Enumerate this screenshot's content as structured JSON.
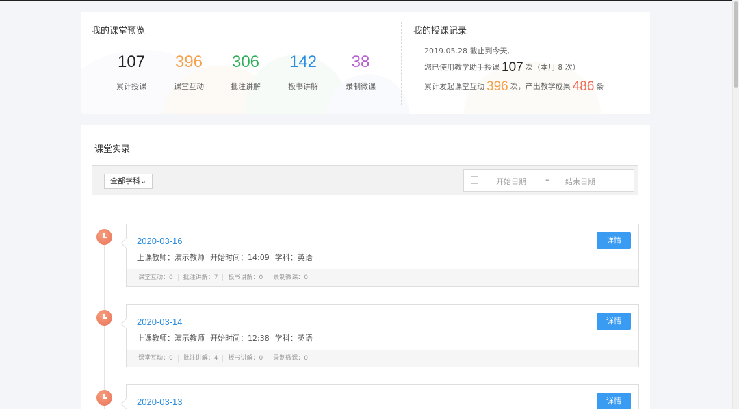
{
  "overview": {
    "title": "我的课堂预览",
    "stats": [
      {
        "value": "107",
        "label": "累计授课",
        "color": "#222222"
      },
      {
        "value": "396",
        "label": "课堂互动",
        "color": "#f5a04a"
      },
      {
        "value": "306",
        "label": "批注讲解",
        "color": "#2fae5a"
      },
      {
        "value": "142",
        "label": "板书讲解",
        "color": "#2b8de0"
      },
      {
        "value": "38",
        "label": "录制微课",
        "color": "#b35fd0"
      }
    ]
  },
  "teaching_record": {
    "title": "我的授课记录",
    "line1": "2019.05.28 截止到今天,",
    "line2_prefix": "您已使用教学助手授课",
    "line2_count": "107",
    "line2_suffix": "次（本月 8 次）",
    "line3_prefix": "累计发起课堂互动",
    "line3_count": "396",
    "line3_mid": "次，产出教学成果",
    "line3_count2": "486",
    "line3_suffix": "条",
    "colors": {
      "count1": "#222222",
      "count2": "#f5a04a",
      "count3": "#ef6b5a"
    }
  },
  "records": {
    "title": "课堂实录",
    "subject_select": "全部学科",
    "subject_chevron": "⌄",
    "date_start_placeholder": "开始日期",
    "date_separator": "–",
    "date_end_placeholder": "结束日期",
    "detail_label": "详情",
    "items": [
      {
        "date": "2020-03-16",
        "teacher": "上课教师：演示教师",
        "start_time": "开始时间：14:09",
        "subject": "学科：英语",
        "stats": [
          "课堂互动：0",
          "批注讲解：7",
          "板书讲解：0",
          "录制微课：0"
        ]
      },
      {
        "date": "2020-03-14",
        "teacher": "上课教师：演示教师",
        "start_time": "开始时间：12:38",
        "subject": "学科：英语",
        "stats": [
          "课堂互动：0",
          "批注讲解：4",
          "板书讲解：0",
          "录制微课：0"
        ]
      },
      {
        "date": "2020-03-13",
        "teacher": "",
        "start_time": "",
        "subject": "",
        "stats": []
      }
    ]
  },
  "icons": {
    "clock": "clock-icon",
    "calendar": "calendar-icon"
  },
  "accent_color": "#3a9bf2"
}
